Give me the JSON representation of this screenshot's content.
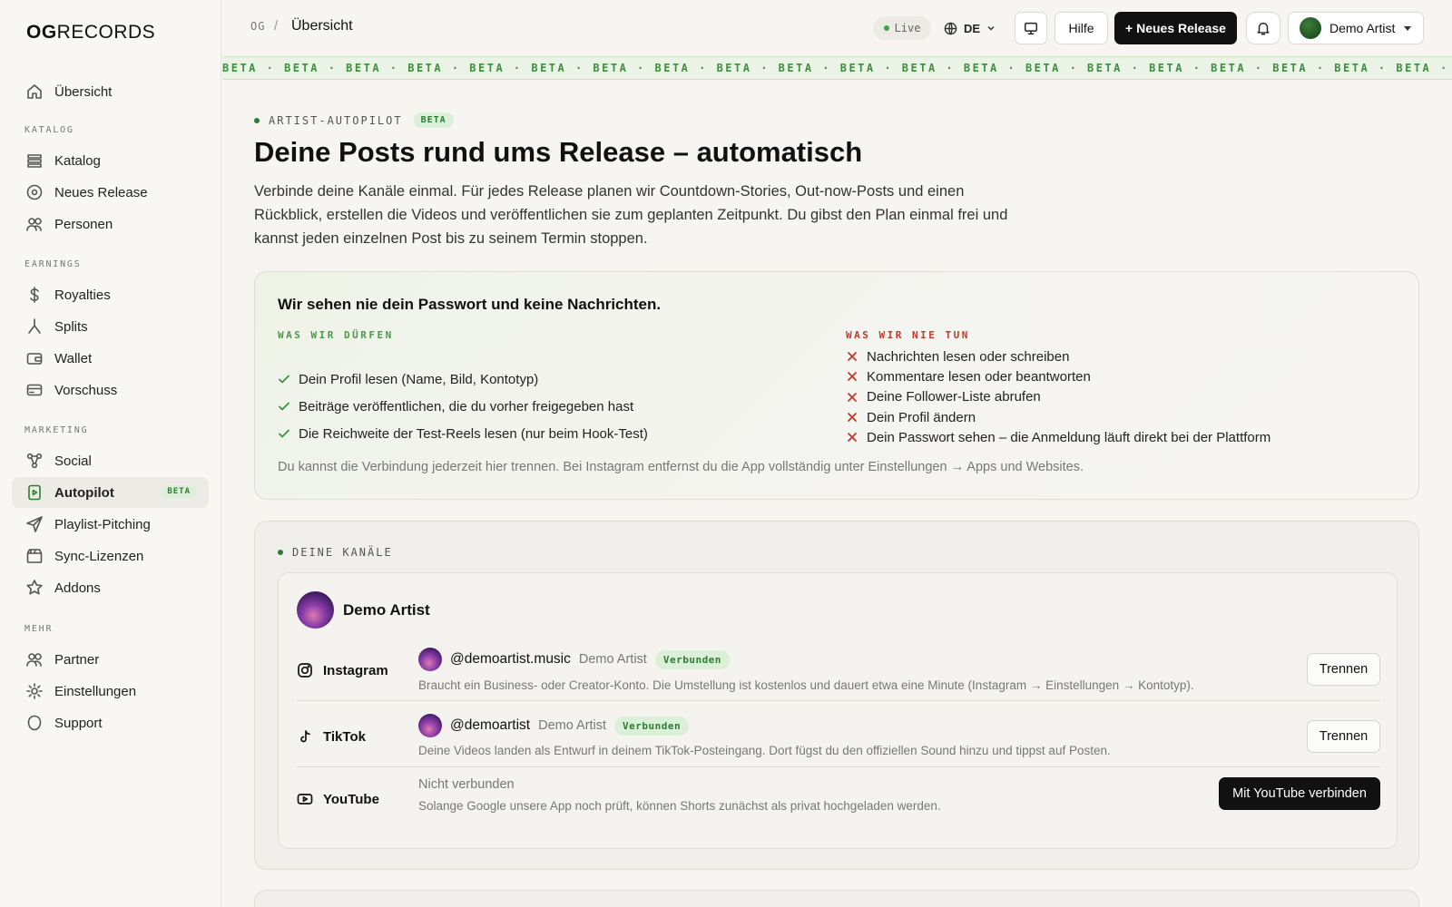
{
  "brand": {
    "logo_bold": "OG",
    "logo_light": "RECORDS"
  },
  "sidebar": {
    "top": [
      {
        "label": "Übersicht",
        "icon": "home-icon"
      }
    ],
    "sections": [
      {
        "title": "KATALOG",
        "items": [
          {
            "label": "Katalog",
            "icon": "catalog-icon"
          },
          {
            "label": "Neues Release",
            "icon": "disc-icon"
          },
          {
            "label": "Personen",
            "icon": "people-icon"
          }
        ]
      },
      {
        "title": "EARNINGS",
        "items": [
          {
            "label": "Royalties",
            "icon": "dollar-icon"
          },
          {
            "label": "Splits",
            "icon": "split-icon"
          },
          {
            "label": "Wallet",
            "icon": "wallet-icon"
          },
          {
            "label": "Vorschuss",
            "icon": "card-icon"
          }
        ]
      },
      {
        "title": "MARKETING",
        "items": [
          {
            "label": "Social",
            "icon": "social-icon"
          },
          {
            "label": "Autopilot",
            "icon": "autopilot-icon",
            "badge": "BETA",
            "active": true
          },
          {
            "label": "Playlist-Pitching",
            "icon": "send-icon"
          },
          {
            "label": "Sync-Lizenzen",
            "icon": "clapper-icon"
          },
          {
            "label": "Addons",
            "icon": "star-icon"
          }
        ]
      },
      {
        "title": "MEHR",
        "items": [
          {
            "label": "Partner",
            "icon": "partner-icon"
          },
          {
            "label": "Einstellungen",
            "icon": "settings-icon"
          },
          {
            "label": "Support",
            "icon": "support-icon"
          }
        ]
      }
    ]
  },
  "header": {
    "crumb_root": "OG",
    "crumb_sep": "/",
    "crumb_current": "Übersicht",
    "live": "Live",
    "lang": "DE",
    "help": "Hilfe",
    "new_release": "+ Neues Release",
    "user": "Demo Artist"
  },
  "beta_band": "BETA · BETA · BETA · BETA · BETA · BETA · BETA · BETA · BETA · BETA · BETA · BETA · BETA · BETA · BETA · BETA · BETA · BETA · BETA · BETA · BETA · BETA · BETA · BETA · BETA · BETA",
  "main": {
    "eyebrow": "ARTIST-AUTOPILOT",
    "eyebrow_badge": "BETA",
    "title": "Deine Posts rund ums Release – automatisch",
    "lead": "Verbinde deine Kanäle einmal. Für jedes Release planen wir Countdown-Stories, Out-now-Posts und einen Rückblick, erstellen die Videos und veröffentlichen sie zum geplanten Zeitpunkt. Du gibst den Plan einmal frei und kannst jeden einzelnen Post bis zu seinem Termin stoppen."
  },
  "privacy": {
    "title": "Wir sehen nie dein Passwort und keine Nachrichten.",
    "allowed_head": "WAS WIR DÜRFEN",
    "allowed": [
      "Dein Profil lesen (Name, Bild, Kontotyp)",
      "Beiträge veröffentlichen, die du vorher freigegeben hast",
      "Die Reichweite der Test-Reels lesen (nur beim Hook-Test)"
    ],
    "never_head": "WAS WIR NIE TUN",
    "never": [
      "Nachrichten lesen oder schreiben",
      "Kommentare lesen oder beantworten",
      "Deine Follower-Liste abrufen",
      "Dein Profil ändern",
      "Dein Passwort sehen – die Anmeldung läuft direkt bei der Plattform"
    ],
    "footer": "Du kannst die Verbindung jederzeit hier trennen. Bei Instagram entfernst du die App vollständig unter Einstellungen → Apps und Websites."
  },
  "channels": {
    "eyebrow": "DEINE KANÄLE",
    "artist": "Demo Artist",
    "rows": [
      {
        "platform": "Instagram",
        "icon": "instagram-icon",
        "handle": "@demoartist.music",
        "display_name": "Demo Artist",
        "status": "Verbunden",
        "note": "Braucht ein Business- oder Creator-Konto. Die Umstellung ist kostenlos und dauert etwa eine Minute (Instagram → Einstellungen → Kontotyp).",
        "action": "Trennen"
      },
      {
        "platform": "TikTok",
        "icon": "tiktok-icon",
        "handle": "@demoartist",
        "display_name": "Demo Artist",
        "status": "Verbunden",
        "note": "Deine Videos landen als Entwurf in deinem TikTok-Posteingang. Dort fügst du den offiziellen Sound hinzu und tippst auf Posten.",
        "action": "Trennen"
      },
      {
        "platform": "YouTube",
        "icon": "youtube-icon",
        "status": "Nicht verbunden",
        "note": "Solange Google unsere App noch prüft, können Shorts zunächst als privat hochgeladen werden.",
        "action": "Mit YouTube verbinden"
      }
    ]
  }
}
